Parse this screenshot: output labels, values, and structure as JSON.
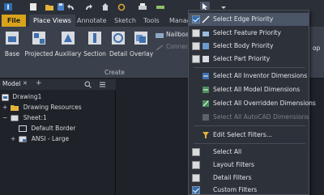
{
  "quick_access": {
    "icons": [
      "app-menu-icon",
      "new-file-icon",
      "open-folder-icon",
      "save-icon",
      "undo-icon",
      "redo-icon",
      "home-icon",
      "update-icon",
      "print-icon",
      "measure-icon",
      "select-filter-icon",
      "customize-qat-icon"
    ]
  },
  "tabs": [
    {
      "label": "File"
    },
    {
      "label": "Place Views"
    },
    {
      "label": "Annotate"
    },
    {
      "label": "Sketch"
    },
    {
      "label": "Tools"
    },
    {
      "label": "Manage"
    }
  ],
  "ribbon": {
    "buttons": [
      {
        "label": "Base",
        "icon": "base-view-icon"
      },
      {
        "label": "Projected",
        "icon": "projected-view-icon"
      },
      {
        "label": "Auxiliary",
        "icon": "auxiliary-view-icon"
      },
      {
        "label": "Section",
        "icon": "section-view-icon"
      },
      {
        "label": "Detail",
        "icon": "detail-view-icon"
      },
      {
        "label": "Overlay",
        "icon": "overlay-view-icon"
      }
    ],
    "side_items": [
      {
        "label": "Nailboar",
        "icon": "nailboard-icon"
      },
      {
        "label": "Connect",
        "icon": "connector-icon"
      }
    ],
    "group_label": "Create",
    "right_cut_label": "op"
  },
  "browser": {
    "tab_label": "Model",
    "close_glyph": "✕",
    "add_glyph": "+",
    "tree": [
      {
        "label": "Drawing1",
        "indent": 0
      },
      {
        "label": "Drawing Resources",
        "indent": 1
      },
      {
        "label": "Sheet:1",
        "indent": 1
      },
      {
        "label": "Default Border",
        "indent": 2
      },
      {
        "label": "ANSI - Large",
        "indent": 2
      }
    ]
  },
  "menu": {
    "items": [
      {
        "label": "Select Edge Priority",
        "kind": "check",
        "checked": true,
        "highlighted": true
      },
      {
        "label": "Select Feature Priority",
        "kind": "check",
        "checked": false
      },
      {
        "label": "Select Body Priority",
        "kind": "check",
        "checked": false
      },
      {
        "label": "Select Part Priority",
        "kind": "check",
        "checked": false
      },
      {
        "label": "Select All Inventor Dimensions",
        "kind": "icon",
        "icon": "inventor-dimensions-icon"
      },
      {
        "label": "Select All Model Dimensions",
        "kind": "icon",
        "icon": "model-dimensions-icon"
      },
      {
        "label": "Select All Overridden Dimensions",
        "kind": "icon",
        "icon": "overridden-dimensions-icon"
      },
      {
        "label": "Select All AutoCAD Dimensions",
        "kind": "icon",
        "icon": "autocad-dimensions-icon",
        "disabled": true
      },
      {
        "label": "Edit Select Filters...",
        "kind": "icon",
        "icon": "edit-filters-icon"
      },
      {
        "label": "Select All",
        "kind": "check",
        "checked": false
      },
      {
        "label": "Layout Filters",
        "kind": "check",
        "checked": false
      },
      {
        "label": "Detail Filters",
        "kind": "check",
        "checked": false
      },
      {
        "label": "Custom Filters",
        "kind": "check",
        "checked": true
      }
    ]
  },
  "colors": {
    "file_tab": "#d8a31b",
    "ribbon_bg": "#3b414c",
    "menu_bg": "#2d3139",
    "check_on": "#2e6fb8"
  }
}
